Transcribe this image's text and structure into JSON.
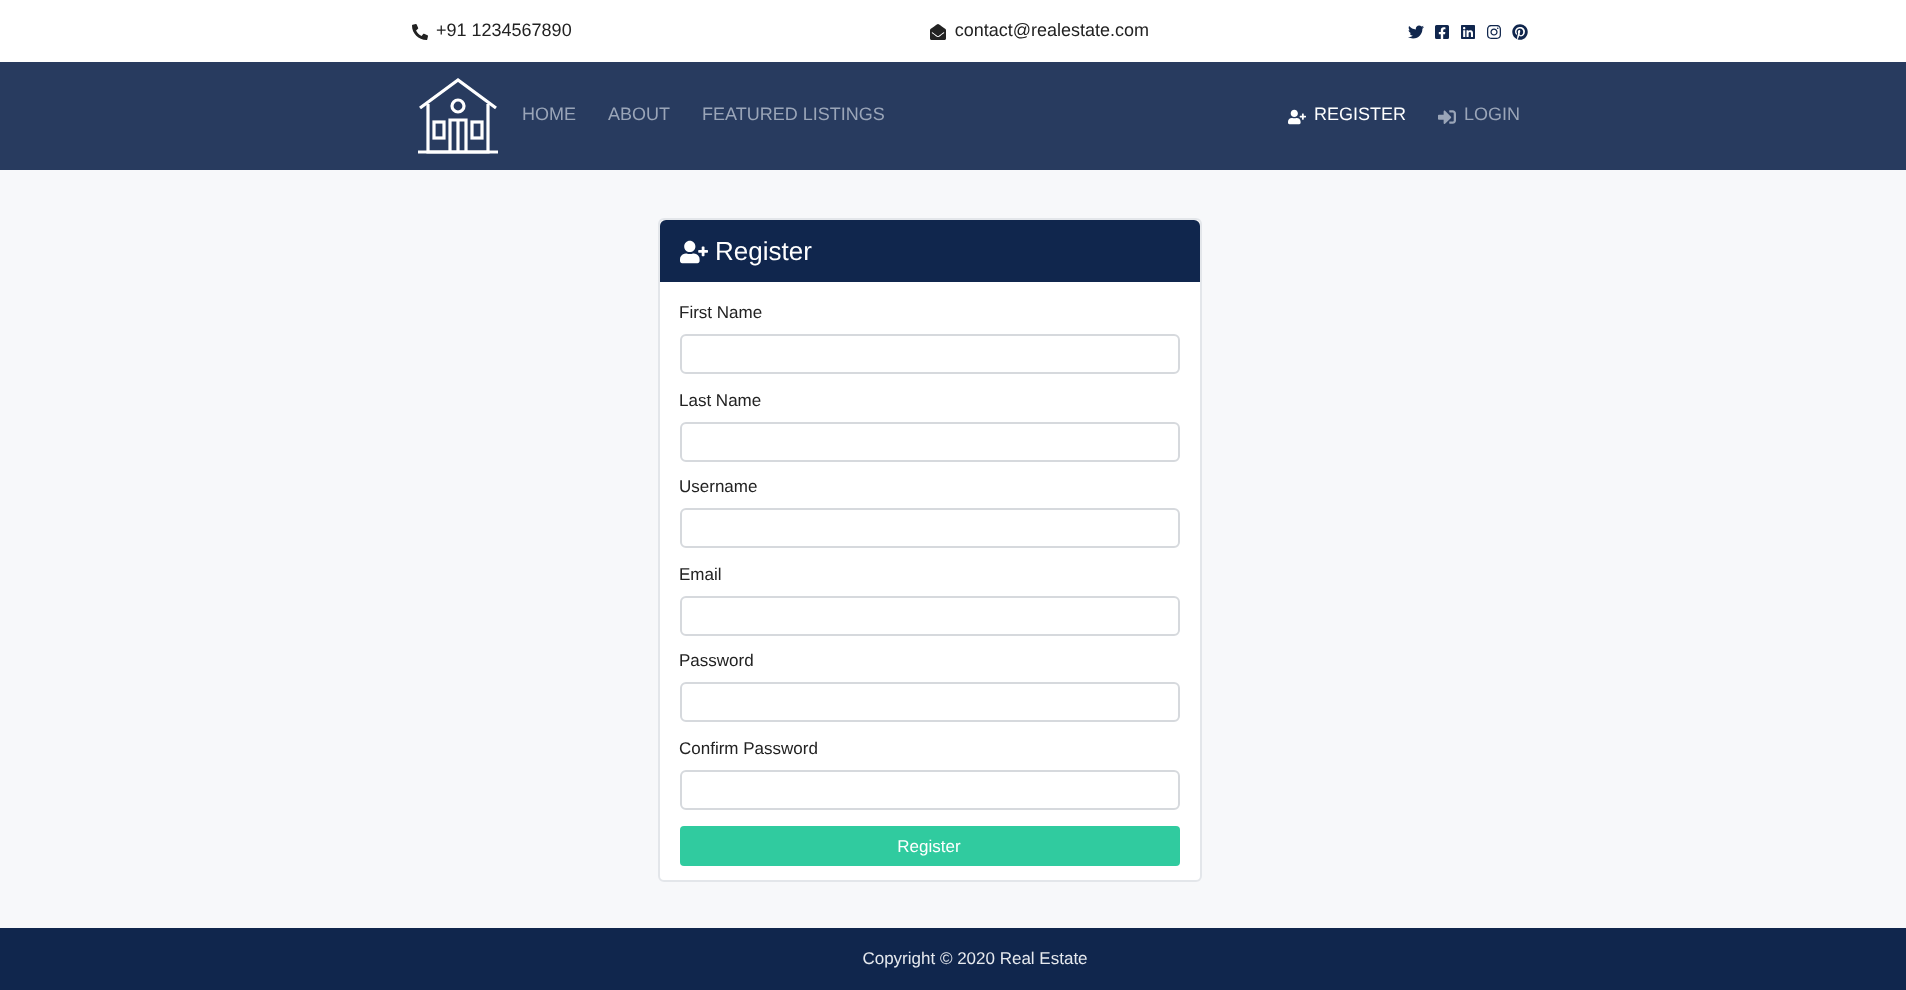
{
  "topbar": {
    "phone": "+91 1234567890",
    "email": "contact@realestate.com",
    "social": [
      {
        "kind": "twitter"
      },
      {
        "kind": "facebook"
      },
      {
        "kind": "linkedin"
      },
      {
        "kind": "instagram"
      },
      {
        "kind": "pinterest"
      }
    ]
  },
  "nav": {
    "left": [
      {
        "label": "HOME",
        "selected": false
      },
      {
        "label": "ABOUT",
        "selected": false
      },
      {
        "label": "FEATURED LISTINGS",
        "selected": false
      }
    ],
    "right": [
      {
        "label": "REGISTER",
        "kind": "register",
        "selected": true
      },
      {
        "label": "LOGIN",
        "kind": "login",
        "selected": false
      }
    ]
  },
  "form": {
    "title": "Register",
    "fields": [
      {
        "label": "First Name"
      },
      {
        "label": "Last Name"
      },
      {
        "label": "Username"
      },
      {
        "label": "Email"
      },
      {
        "label": "Password"
      },
      {
        "label": "Confirm Password"
      }
    ],
    "submit": "Register"
  },
  "footer": {
    "text": "Copyright © 2020 Real Estate"
  }
}
